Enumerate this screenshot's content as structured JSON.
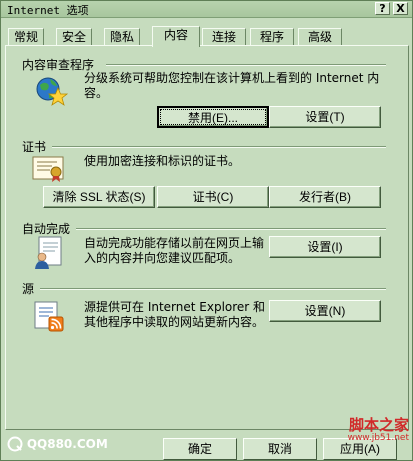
{
  "window": {
    "title": "Internet 选项",
    "help_label": "?",
    "close_label": "X"
  },
  "tabs": [
    {
      "label": "常规"
    },
    {
      "label": "安全"
    },
    {
      "label": "隐私"
    },
    {
      "label": "内容"
    },
    {
      "label": "连接"
    },
    {
      "label": "程序"
    },
    {
      "label": "高级"
    }
  ],
  "active_tab": "内容",
  "content_advisor": {
    "title": "内容审查程序",
    "desc_line1": "分级系统可帮助您控制在该计算机上看到的 Internet 内",
    "desc_line2": "容。",
    "disable_label": "禁用(E)...",
    "settings_label": "设置(T)"
  },
  "certificates": {
    "title": "证书",
    "desc": "使用加密连接和标识的证书。",
    "clear_ssl_label": "清除 SSL 状态(S)",
    "certificates_label": "证书(C)",
    "publishers_label": "发行者(B)"
  },
  "autocomplete": {
    "title": "自动完成",
    "desc_line1": "自动完成功能存储以前在网页上输",
    "desc_line2": "入的内容并向您建议匹配项。",
    "settings_label": "设置(I)"
  },
  "feeds": {
    "title": "源",
    "desc_line1": "源提供可在 Internet Explorer 和",
    "desc_line2": "其他程序中读取的网站更新内容。",
    "settings_label": "设置(N)"
  },
  "footer": {
    "ok_label": "确定",
    "cancel_label": "取消",
    "apply_label": "应用(A)"
  },
  "watermarks": {
    "left": "QQ880.COM",
    "right_main": "脚本之家",
    "right_sub": "www.jb51.net"
  }
}
